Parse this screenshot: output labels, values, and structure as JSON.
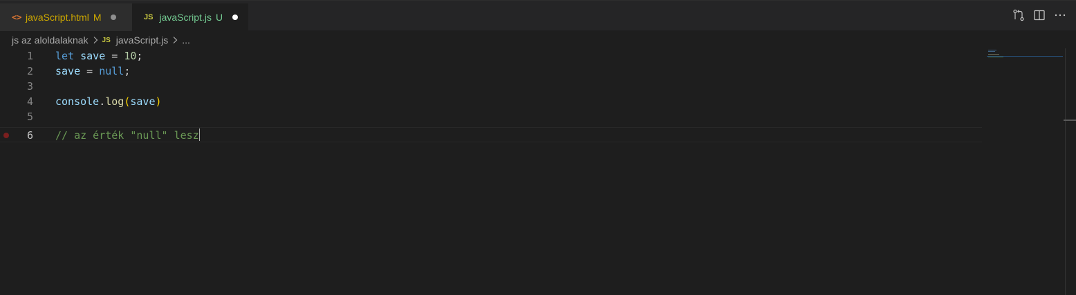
{
  "tabs": [
    {
      "icon": "html-file-icon",
      "icon_glyph": "<>",
      "label": "javaScript.html",
      "status": "M",
      "status_color": "#cca700",
      "active": false,
      "dot": "modified-dot"
    },
    {
      "icon": "js-file-icon",
      "icon_glyph": "JS",
      "label": "javaScript.js",
      "status": "U",
      "status_color": "#73c991",
      "active": true,
      "dot": "unsaved-dot"
    }
  ],
  "actions": [
    {
      "name": "open-changes-icon"
    },
    {
      "name": "split-editor-icon"
    },
    {
      "name": "more-actions-icon",
      "glyph": "···"
    }
  ],
  "breadcrumb": {
    "folder": "js az aloldalaknak",
    "file_icon": "JS",
    "file": "javaScript.js",
    "symbol": "..."
  },
  "editor": {
    "lines": [
      {
        "number": "1"
      },
      {
        "number": "2"
      },
      {
        "number": "3"
      },
      {
        "number": "4"
      },
      {
        "number": "5"
      },
      {
        "number": "6",
        "breakpoint": true,
        "current": true
      }
    ],
    "tokens": {
      "l1": [
        "let",
        "save",
        "=",
        "10",
        ";"
      ],
      "l2": [
        "save",
        "=",
        "null",
        ";"
      ],
      "l4": [
        "console",
        ".",
        "log",
        "(",
        "save",
        ")"
      ],
      "l6": [
        "// az érték \"null\" lesz"
      ]
    }
  },
  "colors": {
    "editor_bg": "#1e1e1e",
    "tabbar_bg": "#252526",
    "keyword": "#569cd6",
    "variable": "#9cdcfe",
    "number": "#b5cea8",
    "function": "#dcdcaa",
    "comment": "#6a9955"
  }
}
